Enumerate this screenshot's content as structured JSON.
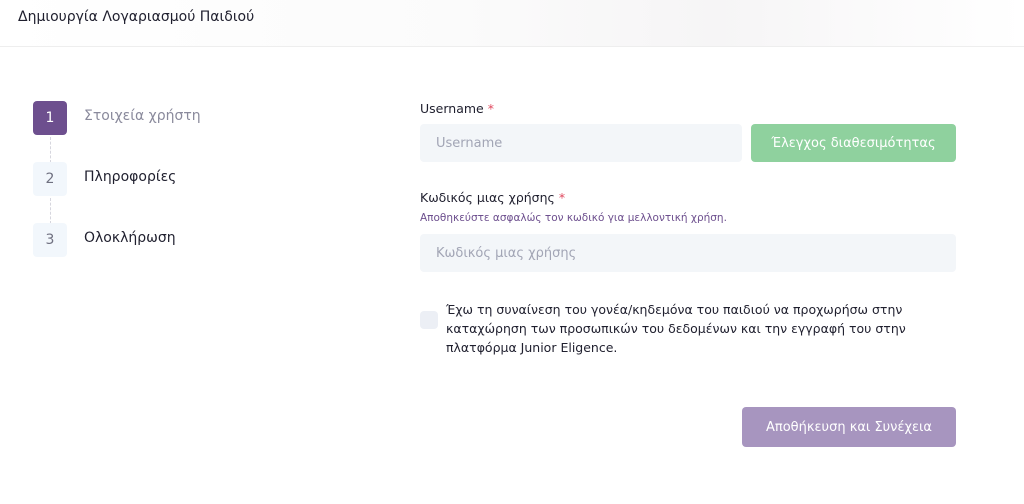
{
  "header": {
    "title": "Δημιουργία Λογαριασμού Παιδιού"
  },
  "steps": [
    {
      "number": "1",
      "label": "Στοιχεία χρήστη",
      "active": true
    },
    {
      "number": "2",
      "label": "Πληροφορίες",
      "active": false
    },
    {
      "number": "3",
      "label": "Ολοκλήρωση",
      "active": false
    }
  ],
  "form": {
    "username_label": "Username",
    "username_required": "*",
    "username_placeholder": "Username",
    "username_value": "",
    "check_availability_label": "Έλεγχος διαθεσιμότητας",
    "password_label": "Κωδικός μιας χρήσης",
    "password_required": "*",
    "password_hint": "Αποθηκεύστε ασφαλώς τον κωδικό για μελλοντική χρήση.",
    "password_placeholder": "Κωδικός μιας χρήσης",
    "password_value": "",
    "consent_text": "Έχω τη συναίνεση του γονέα/κηδεμόνα του παιδιού να προχωρήσω στην καταχώρηση των προσωπικών του δεδομένων και την εγγραφή του στην πλατφόρμα Junior Eligence.",
    "consent_checked": false,
    "submit_label": "Αποθήκευση και Συνέχεια"
  },
  "colors": {
    "accent": "#6d4f8e",
    "check_button": "#8fd19e",
    "submit_button": "#a795bf",
    "required": "#e0485e"
  }
}
